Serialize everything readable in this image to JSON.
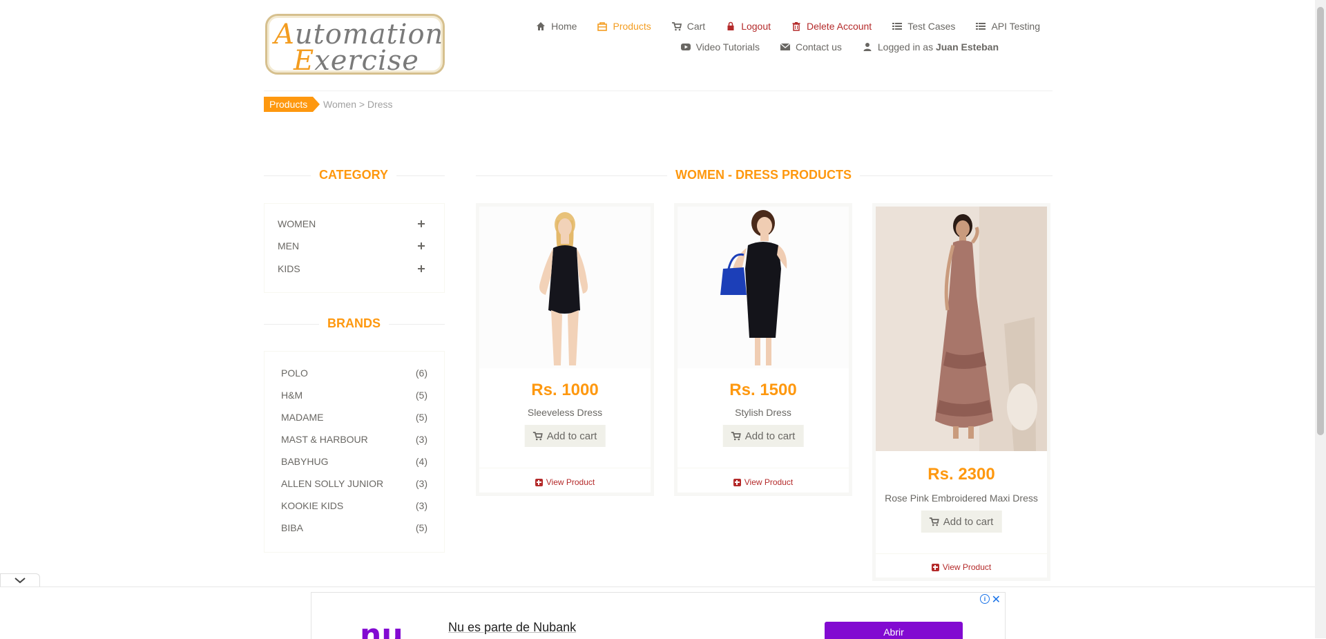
{
  "logo": {
    "line1_cap": "A",
    "line1_rest": "utomation",
    "line2_cap": "E",
    "line2_rest": "xercise"
  },
  "nav": {
    "home": "Home",
    "products": "Products",
    "cart": "Cart",
    "logout": "Logout",
    "delete_account": "Delete Account",
    "test_cases": "Test Cases",
    "api_testing": "API Testing",
    "video_tutorials": "Video Tutorials",
    "contact_us": "Contact us",
    "logged_in_prefix": "Logged in as",
    "user_name": "Juan Esteban"
  },
  "breadcrumb": {
    "tag": "Products",
    "path": "Women > Dress"
  },
  "sidebar": {
    "category_title": "CATEGORY",
    "categories": [
      "Women",
      "Men",
      "Kids"
    ],
    "brands_title": "BRANDS",
    "brands": [
      {
        "name": "POLO",
        "count": "(6)"
      },
      {
        "name": "H&M",
        "count": "(5)"
      },
      {
        "name": "MADAME",
        "count": "(5)"
      },
      {
        "name": "MAST & HARBOUR",
        "count": "(3)"
      },
      {
        "name": "BABYHUG",
        "count": "(4)"
      },
      {
        "name": "ALLEN SOLLY JUNIOR",
        "count": "(3)"
      },
      {
        "name": "KOOKIE KIDS",
        "count": "(3)"
      },
      {
        "name": "BIBA",
        "count": "(5)"
      }
    ]
  },
  "main": {
    "title": "WOMEN - DRESS PRODUCTS",
    "add_to_cart": "Add to cart",
    "view_product": "View Product",
    "products": [
      {
        "price": "Rs. 1000",
        "name": "Sleeveless Dress"
      },
      {
        "price": "Rs. 1500",
        "name": "Stylish Dress"
      },
      {
        "price": "Rs. 2300",
        "name": "Rose Pink Embroidered Maxi Dress"
      }
    ]
  },
  "ad": {
    "logo": "nu",
    "headline": "Nu es parte de Nubank",
    "cta": "Abrir",
    "info": "i",
    "close": "✕"
  },
  "colors": {
    "accent": "#fe980f",
    "danger": "#b42a2a",
    "text": "#696763",
    "ad_purple": "#820ad1"
  }
}
